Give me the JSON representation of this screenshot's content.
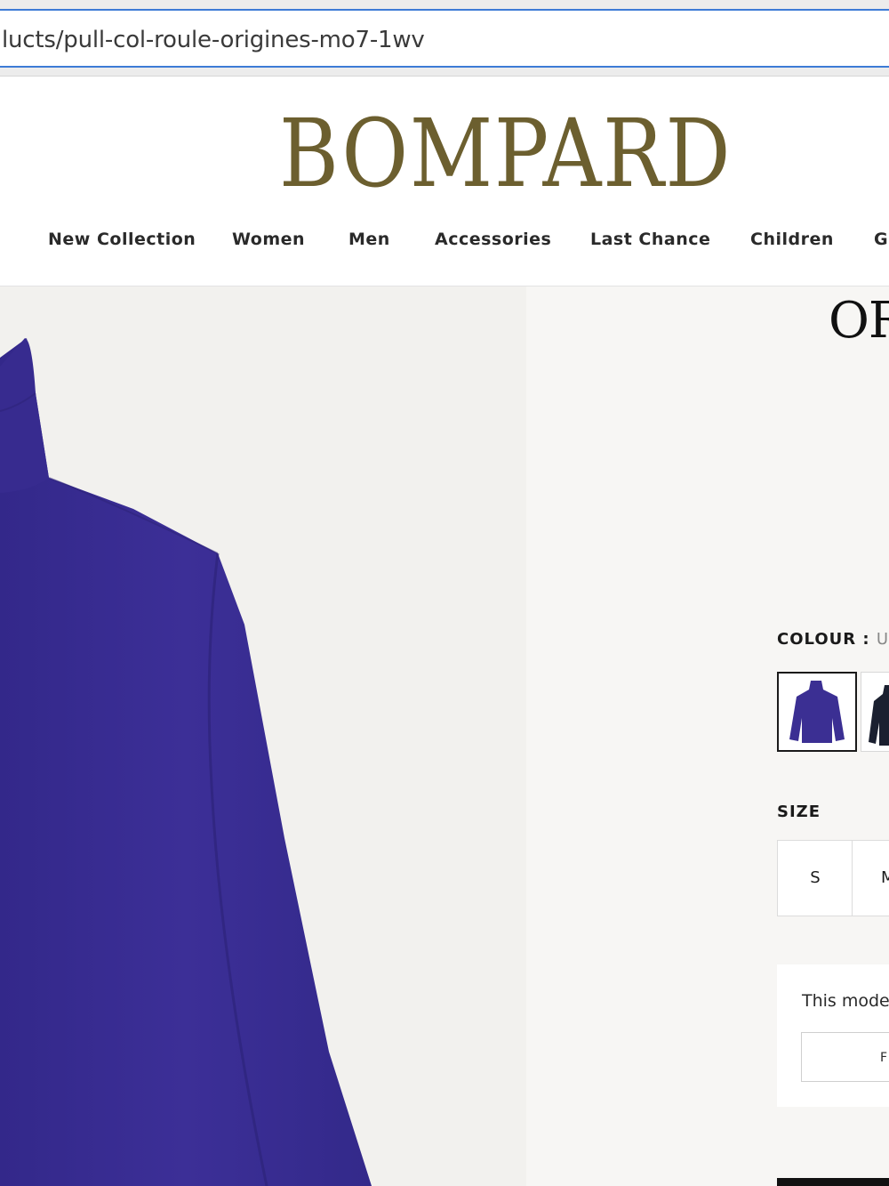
{
  "browser": {
    "url": "lucts/pull-col-roule-origines-mo7-1wv"
  },
  "header": {
    "logo": "BOMPARD",
    "nav": [
      {
        "label": "New Collection"
      },
      {
        "label": "Women"
      },
      {
        "label": "Men"
      },
      {
        "label": "Accessories"
      },
      {
        "label": "Last Chance"
      },
      {
        "label": "Children"
      },
      {
        "label": "Gi"
      }
    ]
  },
  "product": {
    "title": "OR",
    "image_alt_color": "#3a2e8f",
    "colour_label": "COLOUR :",
    "colour_value": "UL",
    "swatches": [
      {
        "name": "ultramarine",
        "color": "#3b2f93",
        "selected": true
      },
      {
        "name": "navy",
        "color": "#1b2030",
        "selected": false
      }
    ],
    "size_label": "SIZE",
    "sizes": [
      "S",
      "M"
    ],
    "model_text": "This mode",
    "model_button": "F"
  },
  "colors": {
    "logo": "#6c5f2f",
    "url_border": "#3d7bd6",
    "sweater": "#3a2e8f"
  }
}
